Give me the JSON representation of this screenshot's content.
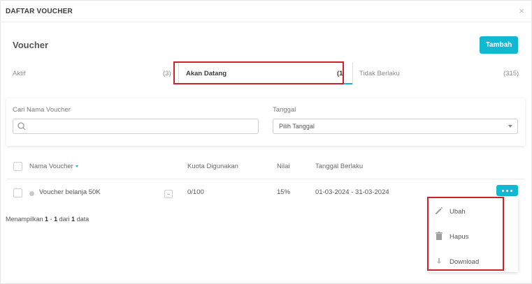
{
  "modal": {
    "title": "DAFTAR VOUCHER",
    "close_glyph": "×"
  },
  "section": {
    "title": "Voucher",
    "add_label": "Tambah"
  },
  "tabs": [
    {
      "label": "Aktif",
      "count": "(3)",
      "active": false
    },
    {
      "label": "Akan Datang",
      "count": "(1",
      "active": true
    },
    {
      "label": "Tidak Berlaku",
      "count": "(315)",
      "active": false
    }
  ],
  "filters": {
    "search_label": "Cari Nama Voucher",
    "search_value": "",
    "date_label": "Tanggal",
    "date_value": "Pilih Tanggal"
  },
  "table": {
    "columns": [
      "Nama Voucher",
      "Kuota Digunakan",
      "Nilai",
      "Tanggal Berlaku"
    ],
    "sorted_column": "Nama Voucher",
    "rows": [
      {
        "name": "Voucher belanja 50K",
        "quota": "0/100",
        "value": "15%",
        "period": "01-03-2024 - 31-03-2024"
      }
    ]
  },
  "pagination": {
    "prefix": "Menampilkan",
    "from": "1",
    "sep": "-",
    "to": "1",
    "of": "dari",
    "total": "1",
    "suffix": "data"
  },
  "row_menu": {
    "items": [
      {
        "label": "Ubah",
        "icon": "pencil-icon"
      },
      {
        "label": "Hapus",
        "icon": "trash-icon"
      },
      {
        "label": "Download",
        "icon": "download-icon"
      }
    ]
  },
  "colors": {
    "accent": "#12b8cf",
    "highlight": "#d0212a"
  }
}
